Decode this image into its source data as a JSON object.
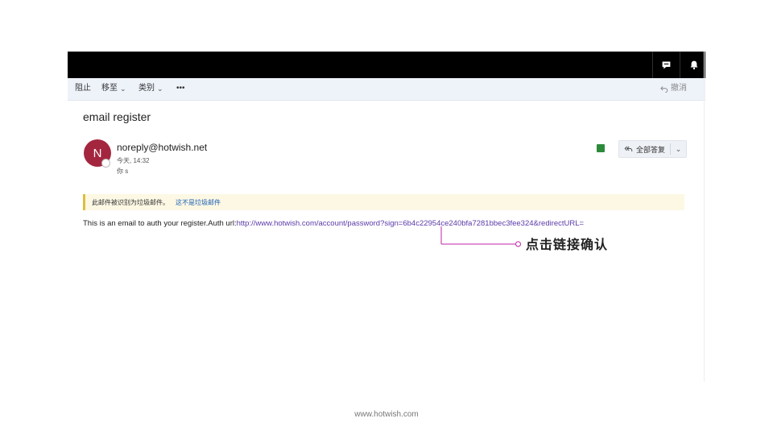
{
  "toolbar": {
    "block_label": "阻止",
    "move_label": "移至",
    "category_label": "类别",
    "more_label": "•••",
    "undo_label": "撤消"
  },
  "icons": {
    "chat": "chat-icon",
    "bell": "bell-icon",
    "undo": "undo-icon",
    "reply_all": "reply-all-icon",
    "chevron": "chevron-down-icon"
  },
  "email": {
    "subject": "email register",
    "avatar_initial": "N",
    "sender": "noreply@hotwish.net",
    "date": "今天, 14:32",
    "to": "你    s",
    "reply_all_label": "全部答复",
    "junk_notice": "此邮件被识别为垃圾邮件。",
    "not_junk_link": "这不是垃圾邮件",
    "body_prefix": "This is an email to auth your register.Auth url:",
    "body_link": "http://www.hotwish.com/account/password?sign=6b4c22954ce240bfa7281bbec3fee324&redirectURL="
  },
  "annotation": {
    "text": "点击链接确认"
  },
  "footer": {
    "url": "www.hotwish.com"
  },
  "colors": {
    "topbar": "#000000",
    "toolbar": "#eef3fa",
    "avatar": "#a4263e",
    "annotation_line": "#c026a8",
    "link": "#5b3aa8",
    "junk_accent": "#e0be3a"
  }
}
